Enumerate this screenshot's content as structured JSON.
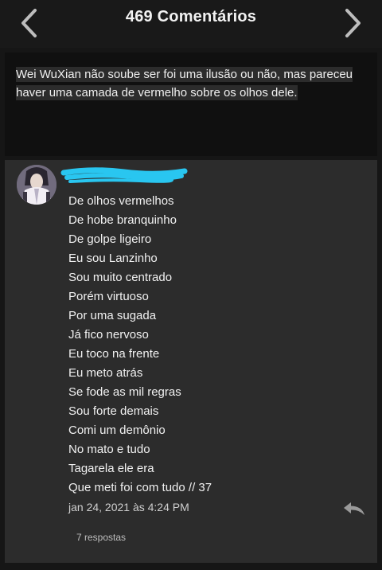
{
  "header": {
    "title": "469 Comentários",
    "prev_icon": "chevron-left-icon",
    "next_icon": "chevron-right-icon"
  },
  "quote": {
    "text": "Wei WuXian não soube ser foi uma ilusão ou não, mas pareceu haver uma camada de vermelho sobre os olhos dele."
  },
  "comment": {
    "lines": [
      "De olhos vermelhos",
      "De hobe branquinho",
      "De golpe ligeiro",
      "Eu sou Lanzinho",
      "Sou muito centrado",
      "Porém virtuoso",
      "Por uma sugada",
      "Já fico nervoso",
      "Eu toco na frente",
      "Eu meto atrás",
      "Se fode as mil regras",
      "Sou forte demais",
      "Comi um demônio",
      "No mato e tudo",
      "Tagarela ele era",
      "Que meti foi com tudo // 37"
    ],
    "timestamp": "jan 24, 2021 às 4:24 PM",
    "replies": "7 respostas",
    "reply_icon": "reply-icon"
  },
  "colors": {
    "background": "#161616",
    "card": "#2c2c2c",
    "redaction": "#29c6f0"
  }
}
